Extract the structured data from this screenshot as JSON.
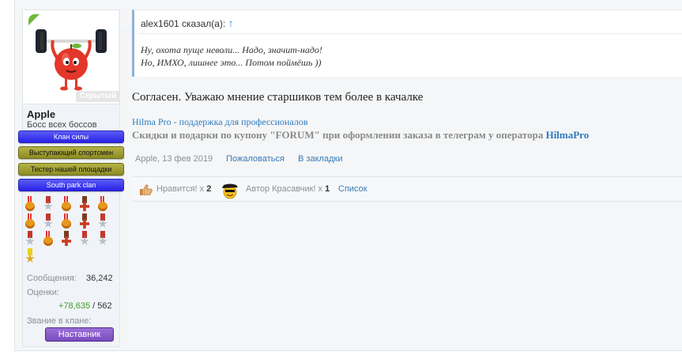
{
  "user": {
    "name": "Apple",
    "title": "Босс всех боссов",
    "hidden_badge": "Скрытый",
    "banners": [
      "Клан силы",
      "Выступающий спортсмен",
      "Тестер нашей площадки",
      "South park clan"
    ],
    "medals": [
      "bear",
      "star",
      "bear",
      "cross",
      "bear",
      "bear",
      "star",
      "bear",
      "cross",
      "star",
      "star",
      "bear",
      "cross",
      "star",
      "star",
      "gold"
    ],
    "stats": {
      "messages_label": "Сообщения:",
      "messages_value": "36,242",
      "ratings_label": "Оценки:",
      "ratings_positive": "+78,635",
      "ratings_separator": " / ",
      "ratings_total": "562",
      "clan_rank_label": "Звание в клане:",
      "clan_rank_value": "Наставник"
    }
  },
  "quote": {
    "author": "alex1601 сказал(а):",
    "arrow": "↑",
    "line1": "Ну, охота пуще неволи... Надо, значит-надо!",
    "line2": "Но, ИМХО, лишнее это... Потом поймёшь ))"
  },
  "message": "Согласен. Уважаю мнение старшиков тем более в качалке",
  "signature": {
    "link": "Hilma Pro - поддержка для профессионалов",
    "text": "Скидки и подарки по купону \"FORUM\" при оформлении заказа в телеграм у оператора ",
    "highlight": "HilmaPro"
  },
  "meta": {
    "author_date": "Apple, 13 фев 2019",
    "report": "Пожаловаться",
    "bookmark": "В закладки"
  },
  "ratings_bar": {
    "like_label": "Нравится!",
    "like_count_prefix": " x ",
    "like_count": "2",
    "cool_label": "Автор Красавчик!",
    "cool_count_prefix": " x ",
    "cool_count": "1",
    "list_link": "Список"
  }
}
